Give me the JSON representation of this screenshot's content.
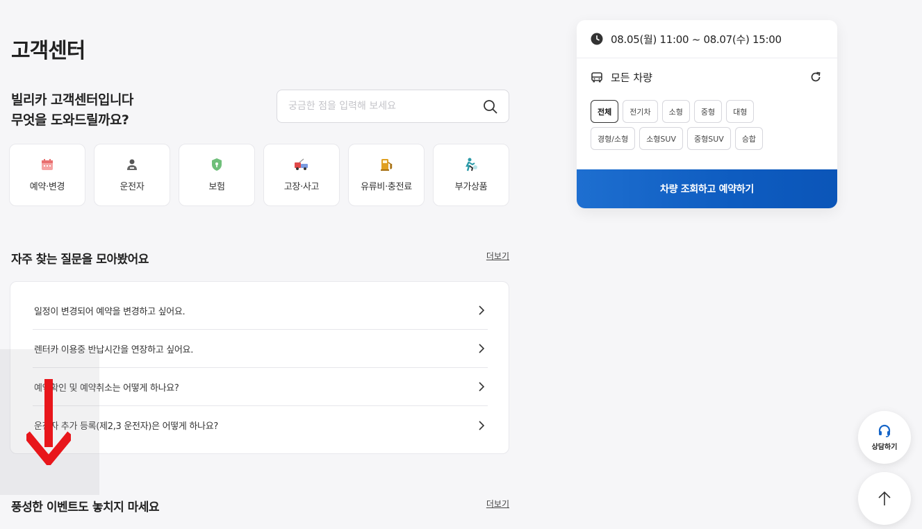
{
  "page": {
    "title": "고객센터"
  },
  "intro": {
    "line1": "빌리카 고객센터입니다",
    "line2": "무엇을 도와드릴까요?"
  },
  "search": {
    "placeholder": "궁금한 점을 입력해 보세요"
  },
  "categories": [
    {
      "label": "예약·변경",
      "icon": "calendar-icon",
      "color": "#f08a8a"
    },
    {
      "label": "운전자",
      "icon": "driver-icon",
      "color": "#555555"
    },
    {
      "label": "보험",
      "icon": "shield-icon",
      "color": "#6fbf7a"
    },
    {
      "label": "고장·사고",
      "icon": "tow-truck-icon",
      "color": "#e04848"
    },
    {
      "label": "유류비·충전료",
      "icon": "fuel-pump-icon",
      "color": "#e0a020"
    },
    {
      "label": "부가상품",
      "icon": "extra-product-icon",
      "color": "#2a9aa8"
    }
  ],
  "faq": {
    "title": "자주 찾는 질문을 모아봤어요",
    "more": "더보기",
    "items": [
      {
        "question": "일정이 변경되어 예약을 변경하고 싶어요."
      },
      {
        "question": "렌터카 이용중 반납시간을 연장하고 싶어요."
      },
      {
        "question": "예약확인 및 예약취소는 어떻게 하나요?"
      },
      {
        "question": "운전자 추가 등록(제2,3 운전자)은 어떻게 하나요?"
      }
    ]
  },
  "events": {
    "title": "풍성한 이벤트도 놓치지 마세요",
    "more": "더보기"
  },
  "booking": {
    "date_range": "08.05(월) 11:00 ~ 08.07(수) 15:00",
    "car_type": "모든 차량",
    "chips": [
      "전체",
      "전기차",
      "소형",
      "중형",
      "대형",
      "경형/소형",
      "소형SUV",
      "중형SUV",
      "승합"
    ],
    "active_chip": "전체",
    "cta": "차량 조회하고 예약하기"
  },
  "floating": {
    "consult": "상담하기"
  },
  "colors": {
    "brand": "#1565c8",
    "arrow": "#e8161b"
  }
}
